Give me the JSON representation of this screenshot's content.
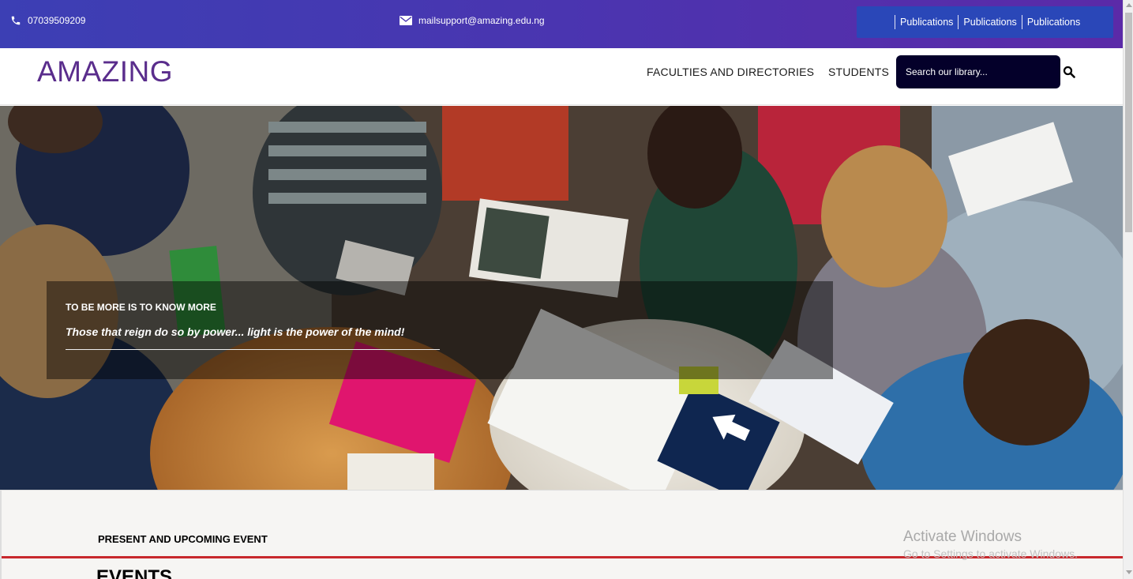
{
  "topbar": {
    "phone": "07039509209",
    "phone_icon": "phone-icon",
    "email": "mailsupport@amazing.edu.ng",
    "email_icon": "envelope-icon",
    "publications": [
      "Publications",
      "Publications",
      "Publications"
    ]
  },
  "navbar": {
    "logo": "AMAZING",
    "items": [
      "FACULTIES AND DIRECTORIES",
      "STUDENTS"
    ],
    "search_placeholder": "Search our library...",
    "search_icon": "magnifier-icon"
  },
  "hero": {
    "heading": "TO BE MORE IS TO KNOW MORE",
    "subtitle": "Those that reign do so by power... light is the power of the mind!"
  },
  "events": {
    "section_label": "PRESENT AND UPCOMING EVENT",
    "title": "EVENTS"
  },
  "watermark": {
    "line1": "Activate Windows",
    "line2": "Go to Settings to activate Windows."
  },
  "colors": {
    "topbar_start": "#3c3fb4",
    "topbar_end": "#5b2aa8",
    "publications_bg": "#2a47b8",
    "logo": "#5a2d8c",
    "search_bg": "#04002a",
    "accent_rule": "#c8282d"
  }
}
